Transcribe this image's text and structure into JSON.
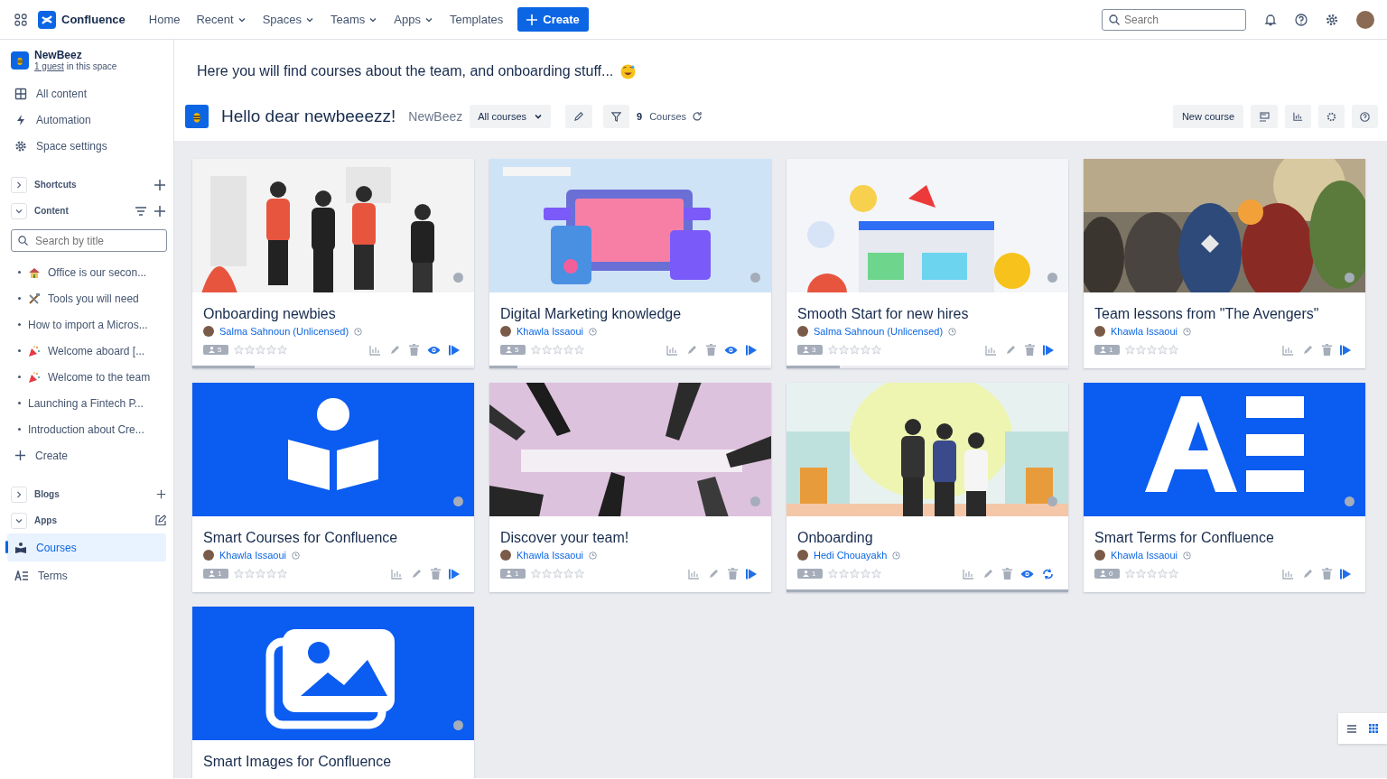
{
  "topbar": {
    "product": "Confluence",
    "nav": [
      {
        "label": "Home",
        "dropdown": false
      },
      {
        "label": "Recent",
        "dropdown": true
      },
      {
        "label": "Spaces",
        "dropdown": true
      },
      {
        "label": "Teams",
        "dropdown": true
      },
      {
        "label": "Apps",
        "dropdown": true
      },
      {
        "label": "Templates",
        "dropdown": false
      }
    ],
    "create": "Create",
    "search": {
      "placeholder": "Search"
    }
  },
  "sidebar": {
    "space": "NewBeez",
    "guests_link": "1 guest",
    "guests_text": "in this space",
    "nav": [
      {
        "label": "All content",
        "kind": "grid"
      },
      {
        "label": "Automation",
        "kind": "bolt"
      },
      {
        "label": "Space settings",
        "kind": "gear"
      }
    ],
    "shortcuts": {
      "label": "Shortcuts",
      "expanded": false
    },
    "content": {
      "label": "Content",
      "expanded": true,
      "search": {
        "placeholder": "Search by title"
      },
      "pages": [
        {
          "title": "Office is our secon...",
          "kind": "house"
        },
        {
          "title": "Tools you will need",
          "kind": "tools"
        },
        {
          "title": "How to import a Micros...",
          "kind": "plain"
        },
        {
          "title": "Welcome aboard [...",
          "kind": "party"
        },
        {
          "title": "Welcome to the team",
          "kind": "party"
        },
        {
          "title": "Launching a Fintech P...",
          "kind": "plain"
        },
        {
          "title": "Introduction about Cre...",
          "kind": "plain"
        }
      ],
      "create": "Create"
    },
    "blogs": {
      "label": "Blogs",
      "expanded": false
    },
    "apps": {
      "label": "Apps",
      "expanded": true,
      "items": [
        {
          "label": "Courses",
          "kind": "courses",
          "selected": true
        },
        {
          "label": "Terms",
          "kind": "terms",
          "selected": false
        }
      ]
    }
  },
  "intro": "Here you will find courses about the team, and onboarding stuff...",
  "header": {
    "title": "Hello dear newbeeezz!",
    "space": "NewBeez",
    "filter": "All courses",
    "count": "9",
    "count_label": "Courses",
    "new_course": "New course"
  },
  "cards": [
    {
      "title": "Onboarding newbies",
      "author": "Salma Sahnoun (Unlicensed)",
      "learners": "5",
      "stars": 0,
      "level": 0.22,
      "kind": "team",
      "actions": [
        {
          "kind": "stats"
        },
        {
          "kind": "edit"
        },
        {
          "kind": "delete"
        },
        {
          "kind": "view"
        },
        {
          "kind": "play"
        }
      ]
    },
    {
      "title": "Digital Marketing knowledge",
      "author": "Khawla Issaoui",
      "learners": "5",
      "stars": 0,
      "level": 0.1,
      "kind": "marketing",
      "actions": [
        {
          "kind": "stats"
        },
        {
          "kind": "edit"
        },
        {
          "kind": "delete"
        },
        {
          "kind": "view"
        },
        {
          "kind": "play"
        }
      ]
    },
    {
      "title": "Smooth Start for new hires",
      "author": "Salma Sahnoun (Unlicensed)",
      "learners": "3",
      "stars": 0,
      "level": 0.19,
      "kind": "ideas",
      "actions": [
        {
          "kind": "stats"
        },
        {
          "kind": "edit"
        },
        {
          "kind": "delete"
        },
        {
          "kind": "play"
        }
      ]
    },
    {
      "title": "Team lessons from \"The Avengers\"",
      "author": "Khawla Issaoui",
      "learners": "1",
      "stars": 0,
      "actions": [
        {
          "kind": "stats"
        },
        {
          "kind": "edit"
        },
        {
          "kind": "delete"
        },
        {
          "kind": "play"
        }
      ]
    },
    {
      "title": "Smart Courses for Confluence",
      "author": "Khawla Issaoui",
      "learners": "1",
      "stars": 0,
      "kind": "book",
      "actions": [
        {
          "kind": "stats"
        },
        {
          "kind": "edit"
        },
        {
          "kind": "delete"
        },
        {
          "kind": "play"
        }
      ]
    },
    {
      "title": "Discover your team!",
      "author": "Khawla Issaoui",
      "learners": "1",
      "stars": 0,
      "kind": "hands",
      "actions": [
        {
          "kind": "stats"
        },
        {
          "kind": "edit"
        },
        {
          "kind": "delete"
        },
        {
          "kind": "play"
        }
      ]
    },
    {
      "title": "Onboarding",
      "author": "Hedi Chouayakh",
      "learners": "1",
      "stars": 0,
      "level": 1,
      "kind": "welcome",
      "actions": [
        {
          "kind": "stats"
        },
        {
          "kind": "edit"
        },
        {
          "kind": "delete"
        },
        {
          "kind": "view"
        },
        {
          "kind": "replay"
        }
      ]
    },
    {
      "title": "Smart Terms for Confluence",
      "author": "Khawla Issaoui",
      "learners": "0",
      "stars": 0,
      "kind": "letters",
      "actions": [
        {
          "kind": "stats"
        },
        {
          "kind": "edit"
        },
        {
          "kind": "delete"
        },
        {
          "kind": "play"
        }
      ]
    },
    {
      "title": "Smart Images for Confluence"
    }
  ],
  "view_toggle": [
    {
      "kind": "list",
      "selected": false
    },
    {
      "kind": "grid",
      "selected": true
    }
  ]
}
